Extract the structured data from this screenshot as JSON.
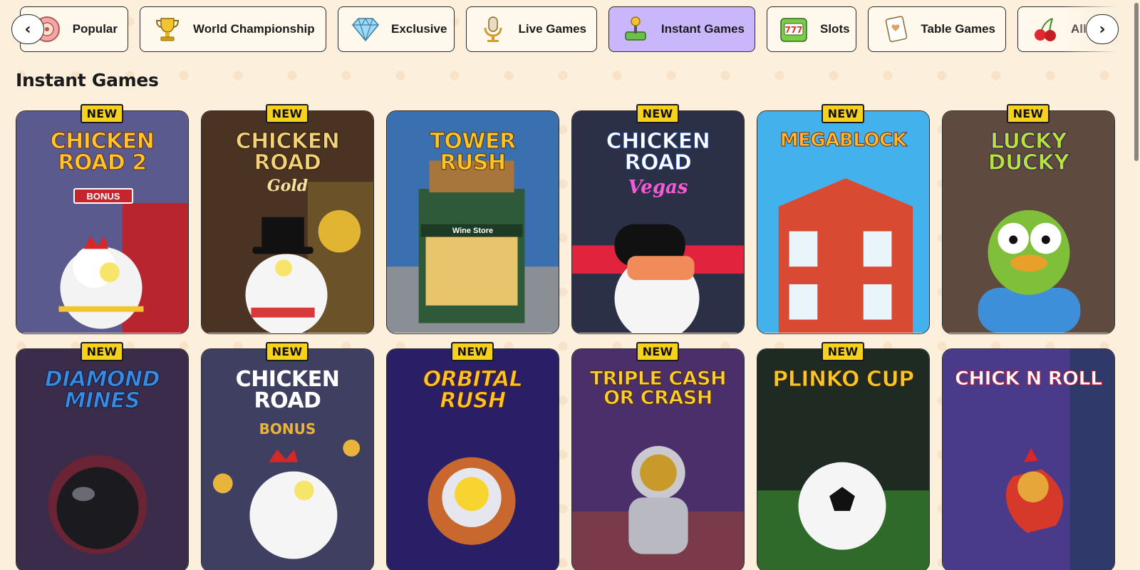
{
  "categories": [
    {
      "label": "Popular",
      "icon": "roulette-icon",
      "active": false
    },
    {
      "label": "World Championship",
      "icon": "trophy-icon",
      "active": false
    },
    {
      "label": "Exclusive",
      "icon": "diamond-icon",
      "active": false
    },
    {
      "label": "Live Games",
      "icon": "microphone-icon",
      "active": false
    },
    {
      "label": "Instant Games",
      "icon": "joystick-icon",
      "active": true
    },
    {
      "label": "Slots",
      "icon": "slot-machine-icon",
      "active": false
    },
    {
      "label": "Table Games",
      "icon": "playing-card-icon",
      "active": false
    },
    {
      "label": "All",
      "icon": "cherries-icon",
      "active": false
    }
  ],
  "nav": {
    "prev": "‹",
    "next": "›"
  },
  "section": {
    "title": "Instant Games"
  },
  "badge_label": "NEW",
  "games": [
    {
      "title": "CHICKEN ROAD 2",
      "sub": "BONUS",
      "new": true
    },
    {
      "title": "CHICKEN ROAD",
      "sub": "Gold",
      "new": true
    },
    {
      "title": "TOWER RUSH",
      "sub": "Wine Store",
      "new": false
    },
    {
      "title": "CHICKEN ROAD",
      "sub": "Vegas",
      "new": true
    },
    {
      "title": "MEGABLOCK",
      "sub": "",
      "new": true
    },
    {
      "title": "LUCKY DUCKY",
      "sub": "",
      "new": true
    },
    {
      "title": "DIAMOND MINES",
      "sub": "",
      "new": true
    },
    {
      "title": "CHICKEN ROAD",
      "sub": "BONUS",
      "new": true
    },
    {
      "title": "ORBITAL RUSH",
      "sub": "",
      "new": true
    },
    {
      "title": "TRIPLE CASH OR CRASH",
      "sub": "",
      "new": true
    },
    {
      "title": "PLINKO CUP",
      "sub": "",
      "new": true
    },
    {
      "title": "CHICK N ROLL",
      "sub": "",
      "new": false
    }
  ],
  "colors": {
    "page_bg": "#fcefdc",
    "active_tab": "#cab7fb",
    "badge": "#f7d21c"
  }
}
